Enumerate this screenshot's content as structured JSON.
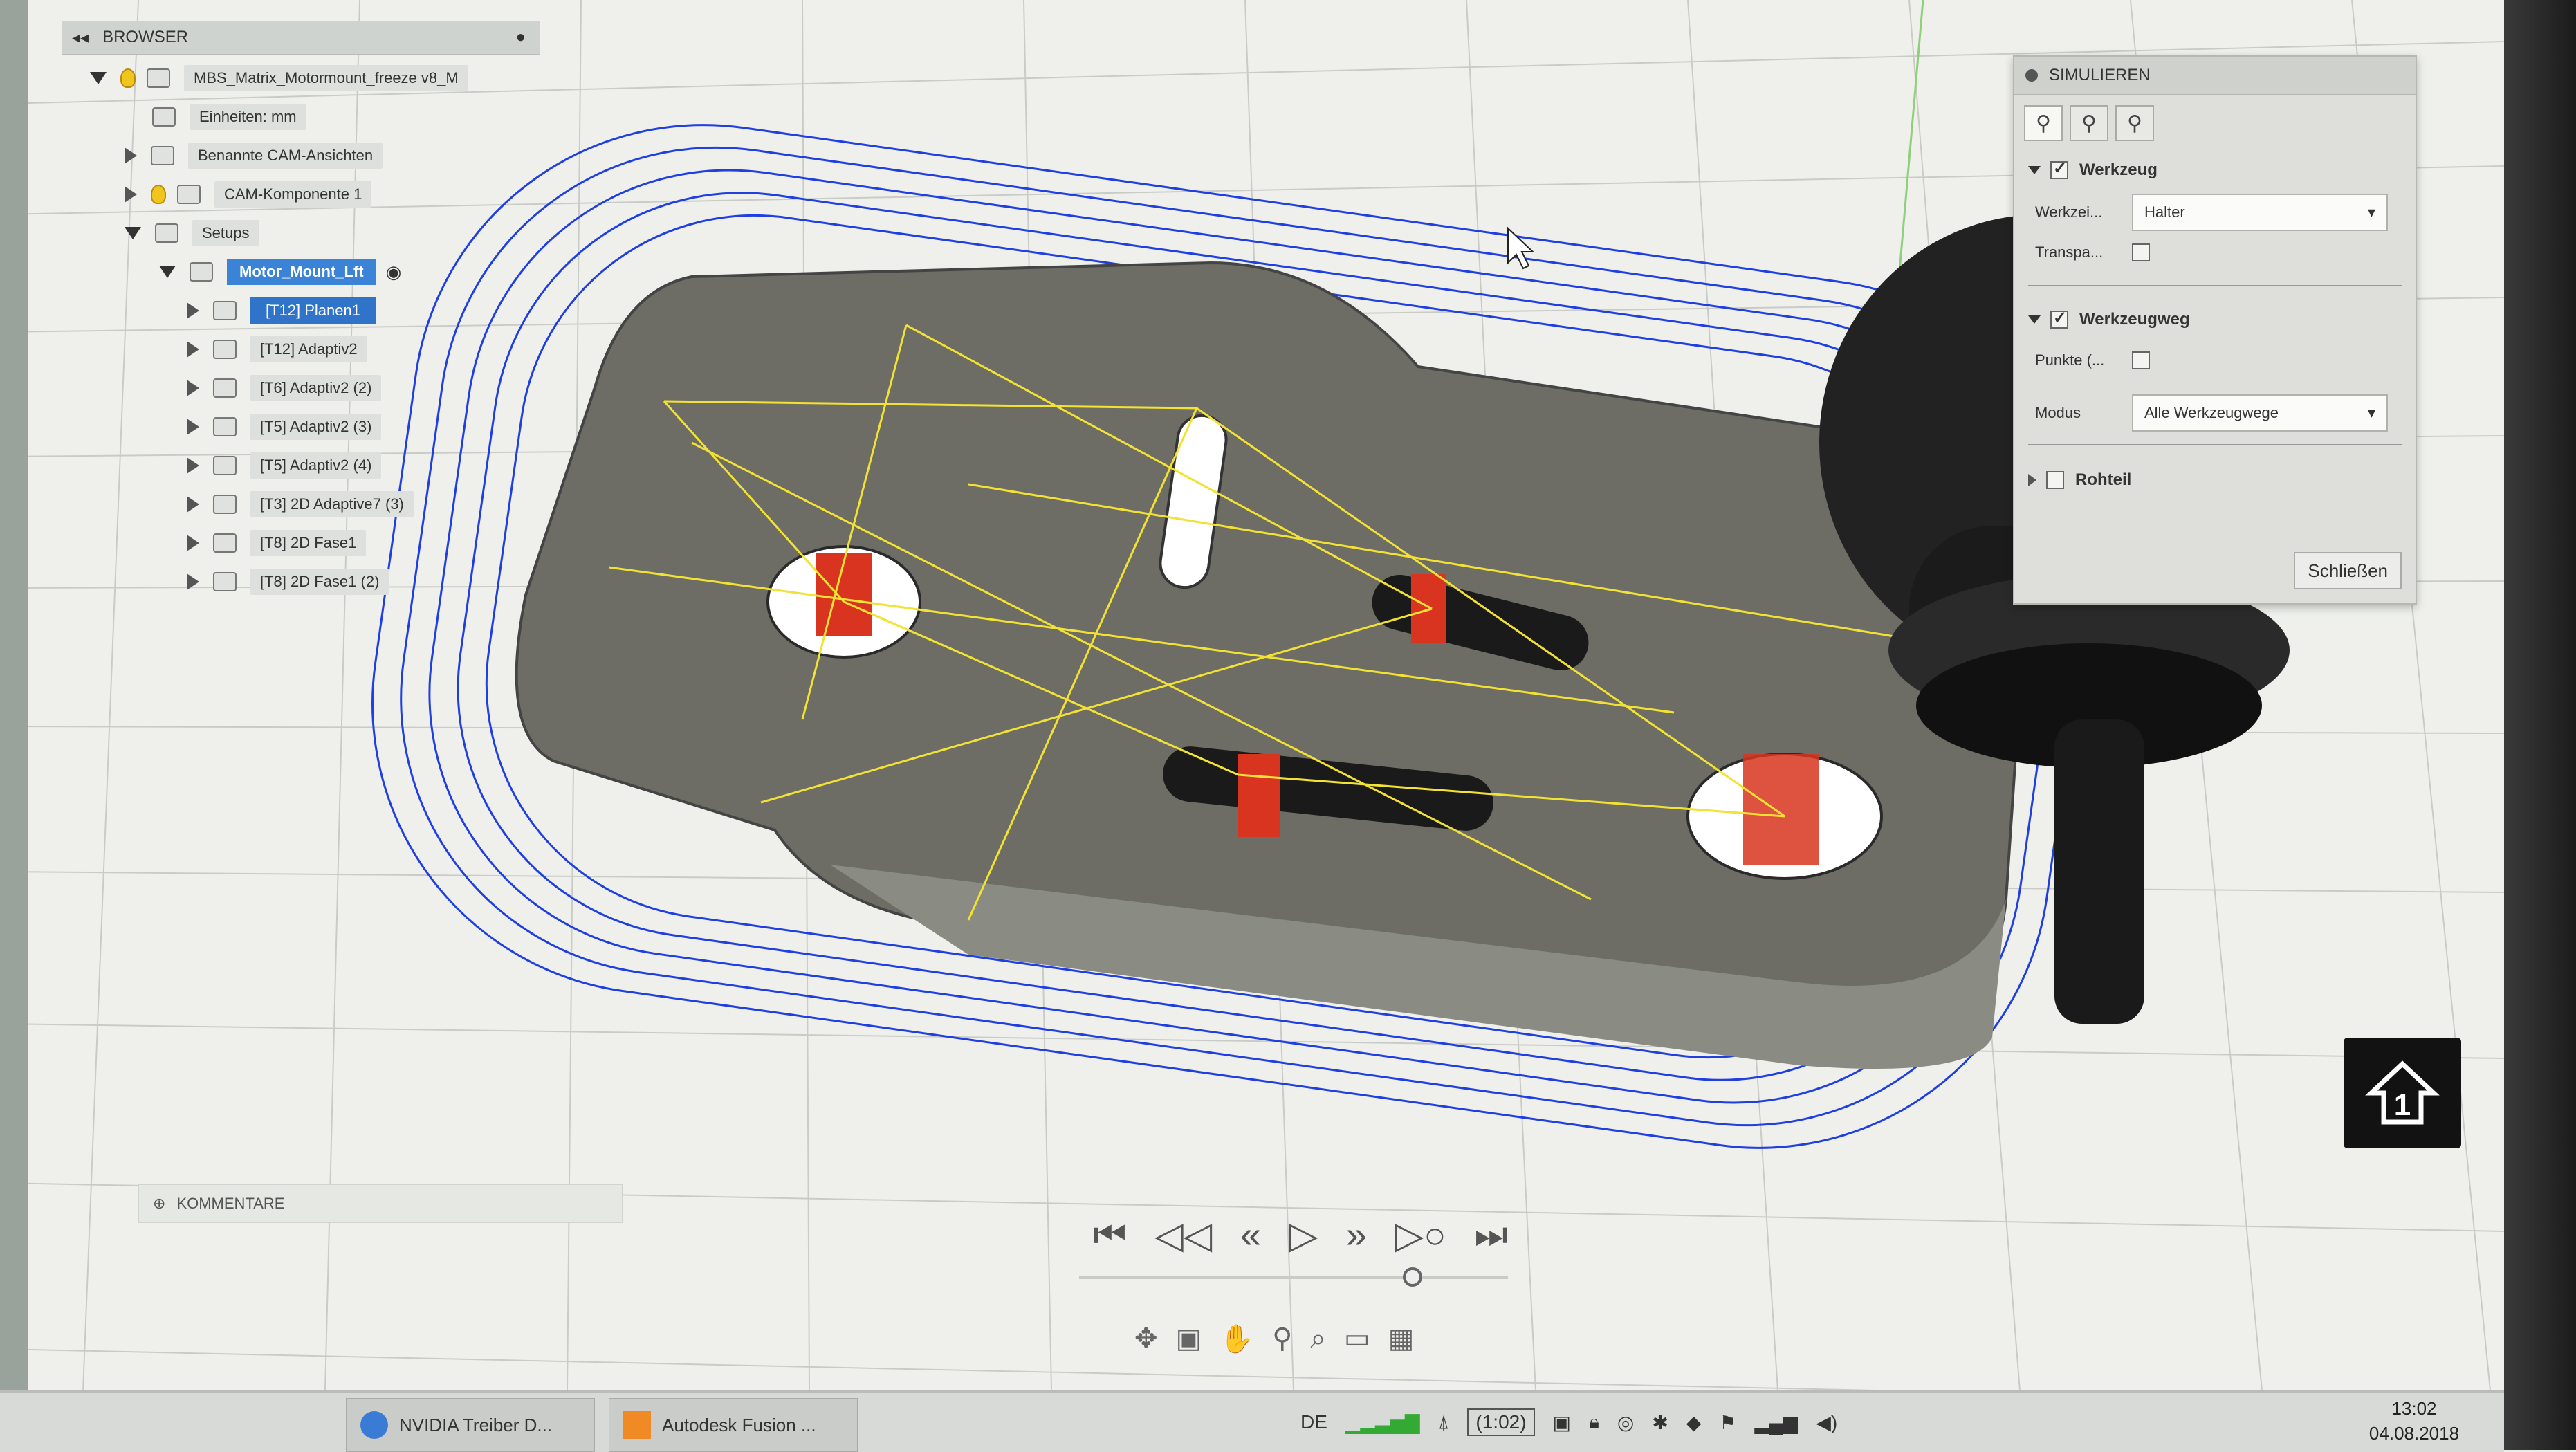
{
  "browser": {
    "header_title": "BROWSER",
    "root_item": "MBS_Matrix_Motormount_freeze v8_M",
    "units": "Einheiten: mm",
    "named_views": "Benannte CAM-Ansichten",
    "component": "CAM-Komponente 1",
    "setups": "Setups",
    "setup_name": "Motor_Mount_Lft",
    "operations": [
      "[T12] Planen1",
      "[T12] Adaptiv2",
      "[T6] Adaptiv2 (2)",
      "[T5] Adaptiv2 (3)",
      "[T5] Adaptiv2 (4)",
      "[T3] 2D Adaptive7 (3)",
      "[T8] 2D Fase1",
      "[T8] 2D Fase1 (2)"
    ]
  },
  "simulation_panel": {
    "title": "SIMULIEREN",
    "section_tool": "Werkzeug",
    "tool_label": "Werkzei...",
    "tool_value": "Halter",
    "transparency_label": "Transpa...",
    "section_toolpath": "Werkzeugweg",
    "points_label": "Punkte (...",
    "mode_label": "Modus",
    "mode_value": "Alle Werkzeugwege",
    "section_stock": "Rohteil",
    "close_button": "Schließen"
  },
  "comments": {
    "label": "KOMMENTARE"
  },
  "home": {
    "label": "1"
  },
  "taskbar": {
    "items": [
      "NVIDIA Treiber D...",
      "Autodesk Fusion ..."
    ],
    "language": "DE",
    "battery": "(1:02)",
    "time": "13:02",
    "date": "04.08.2018"
  },
  "colors": {
    "accent": "#3b83d6",
    "toolpath_blue": "#1f3fe0",
    "toolpath_yellow": "#f2e233",
    "part_gray": "#6f6f68",
    "marker_red": "#d8341f"
  }
}
